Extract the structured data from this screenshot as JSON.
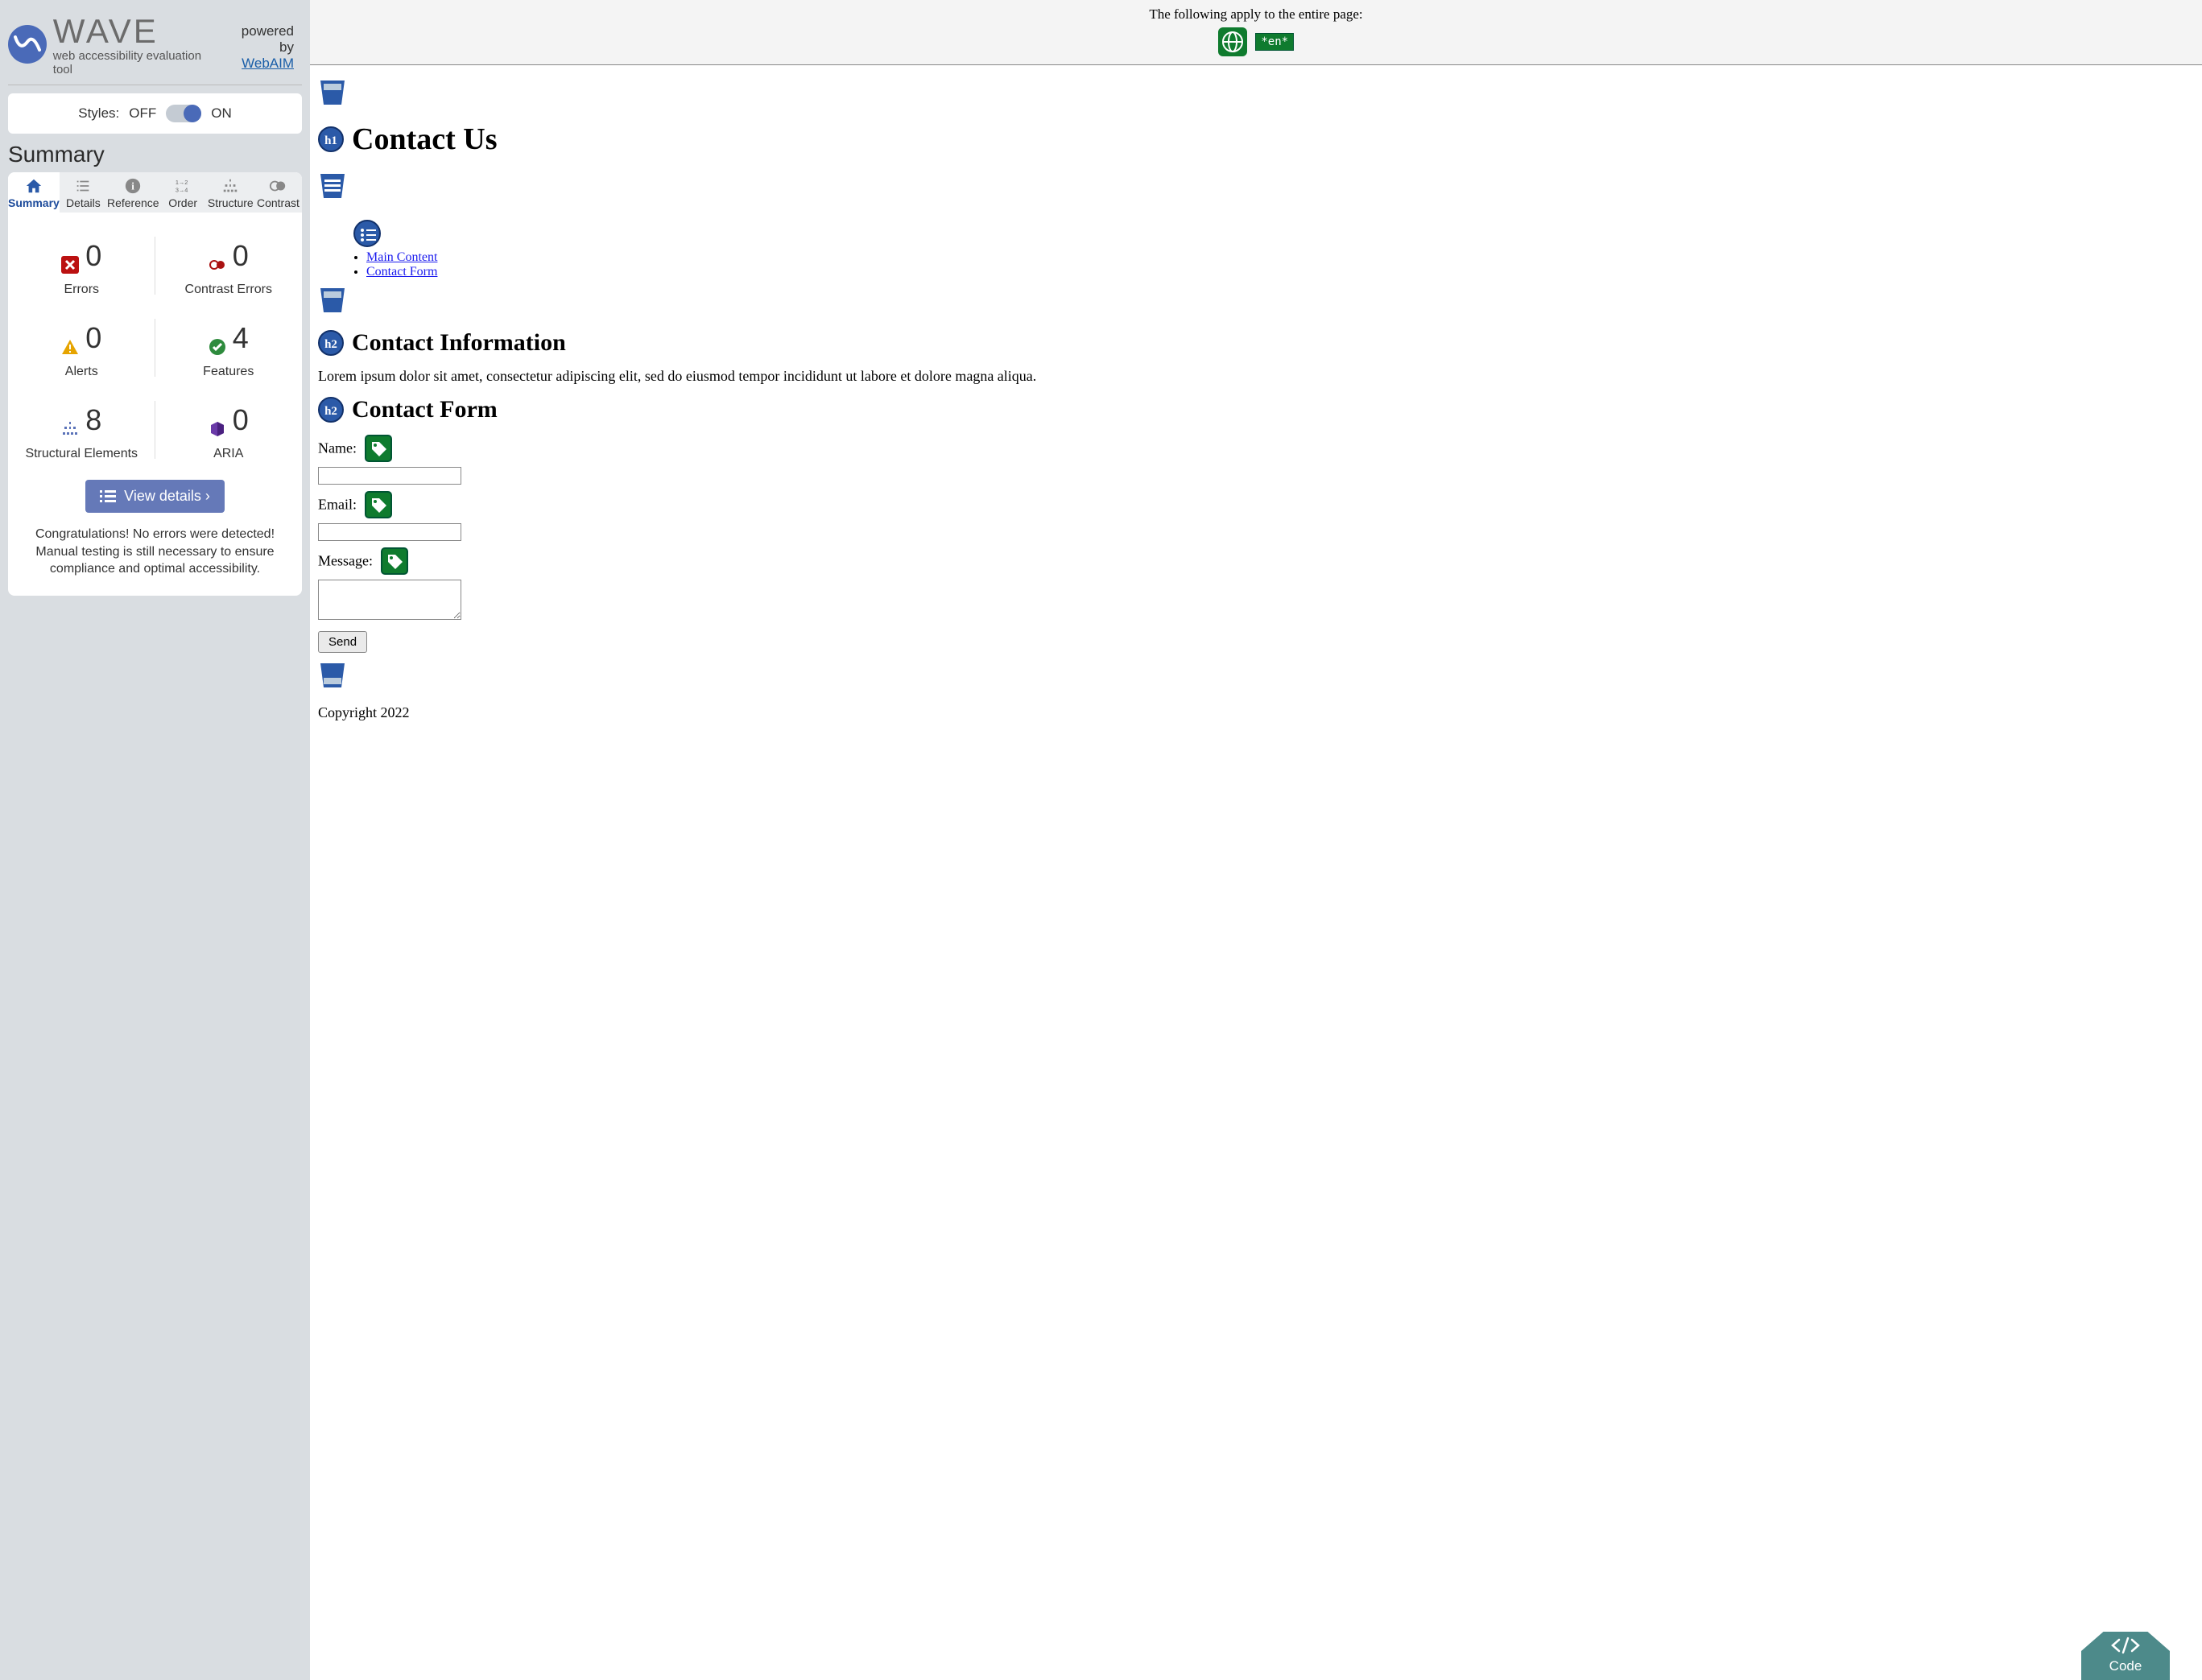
{
  "brand": {
    "title": "WAVE",
    "subtitle": "web accessibility evaluation tool",
    "powered_label": "powered by",
    "powered_link": "WebAIM"
  },
  "styles_toggle": {
    "label": "Styles:",
    "off": "OFF",
    "on": "ON"
  },
  "panel_title": "Summary",
  "tabs": {
    "summary": "Summary",
    "details": "Details",
    "reference": "Reference",
    "order": "Order",
    "structure": "Structure",
    "contrast": "Contrast"
  },
  "counts": {
    "errors": {
      "value": "0",
      "label": "Errors"
    },
    "contrast": {
      "value": "0",
      "label": "Contrast Errors"
    },
    "alerts": {
      "value": "0",
      "label": "Alerts"
    },
    "features": {
      "value": "4",
      "label": "Features"
    },
    "structural": {
      "value": "8",
      "label": "Structural Elements"
    },
    "aria": {
      "value": "0",
      "label": "ARIA"
    }
  },
  "view_details_btn": "View details ›",
  "congrats": "Congratulations! No errors were detected! Manual testing is still necessary to ensure compliance and optimal accessibility.",
  "page": {
    "banner_text": "The following apply to the entire page:",
    "lang_badge": "*en*",
    "h1_badge": "h1",
    "h1_text": "Contact Us",
    "skip_links": {
      "a": "Main Content",
      "b": "Contact Form"
    },
    "h2a_badge": "h2",
    "h2a_text": "Contact Information",
    "paragraph": "Lorem ipsum dolor sit amet, consectetur adipiscing elit, sed do eiusmod tempor incididunt ut labore et dolore magna aliqua.",
    "h2b_badge": "h2",
    "h2b_text": "Contact Form",
    "form": {
      "name_label": "Name:",
      "email_label": "Email:",
      "message_label": "Message:",
      "send": "Send"
    },
    "footer": "Copyright 2022"
  },
  "code_fab": "Code"
}
